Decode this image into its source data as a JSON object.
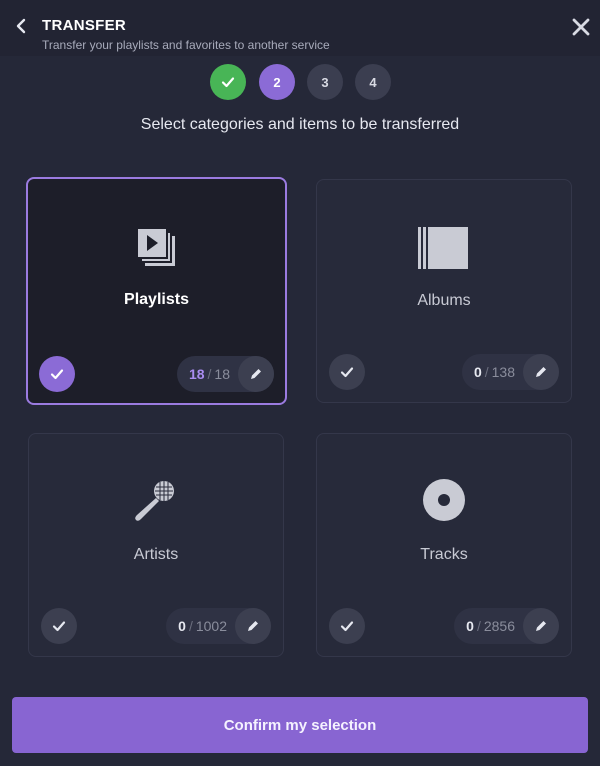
{
  "header": {
    "title": "TRANSFER",
    "subtitle": "Transfer your playlists and favorites to another service"
  },
  "steps": [
    {
      "label": "",
      "state": "done"
    },
    {
      "label": "2",
      "state": "active"
    },
    {
      "label": "3",
      "state": "todo"
    },
    {
      "label": "4",
      "state": "todo"
    }
  ],
  "heading": "Select categories and items to be transferred",
  "categories": [
    {
      "name": "Playlists",
      "selected": true,
      "count": "18",
      "total": "18",
      "icon": "playlists-icon"
    },
    {
      "name": "Albums",
      "selected": false,
      "count": "0",
      "total": "138",
      "icon": "album-icon"
    },
    {
      "name": "Artists",
      "selected": false,
      "count": "0",
      "total": "1002",
      "icon": "microphone-icon"
    },
    {
      "name": "Tracks",
      "selected": false,
      "count": "0",
      "total": "2856",
      "icon": "disc-icon"
    }
  ],
  "confirm_label": "Confirm my selection",
  "colors": {
    "accent": "#8b6bd6",
    "success": "#48b556",
    "background": "#252838"
  }
}
